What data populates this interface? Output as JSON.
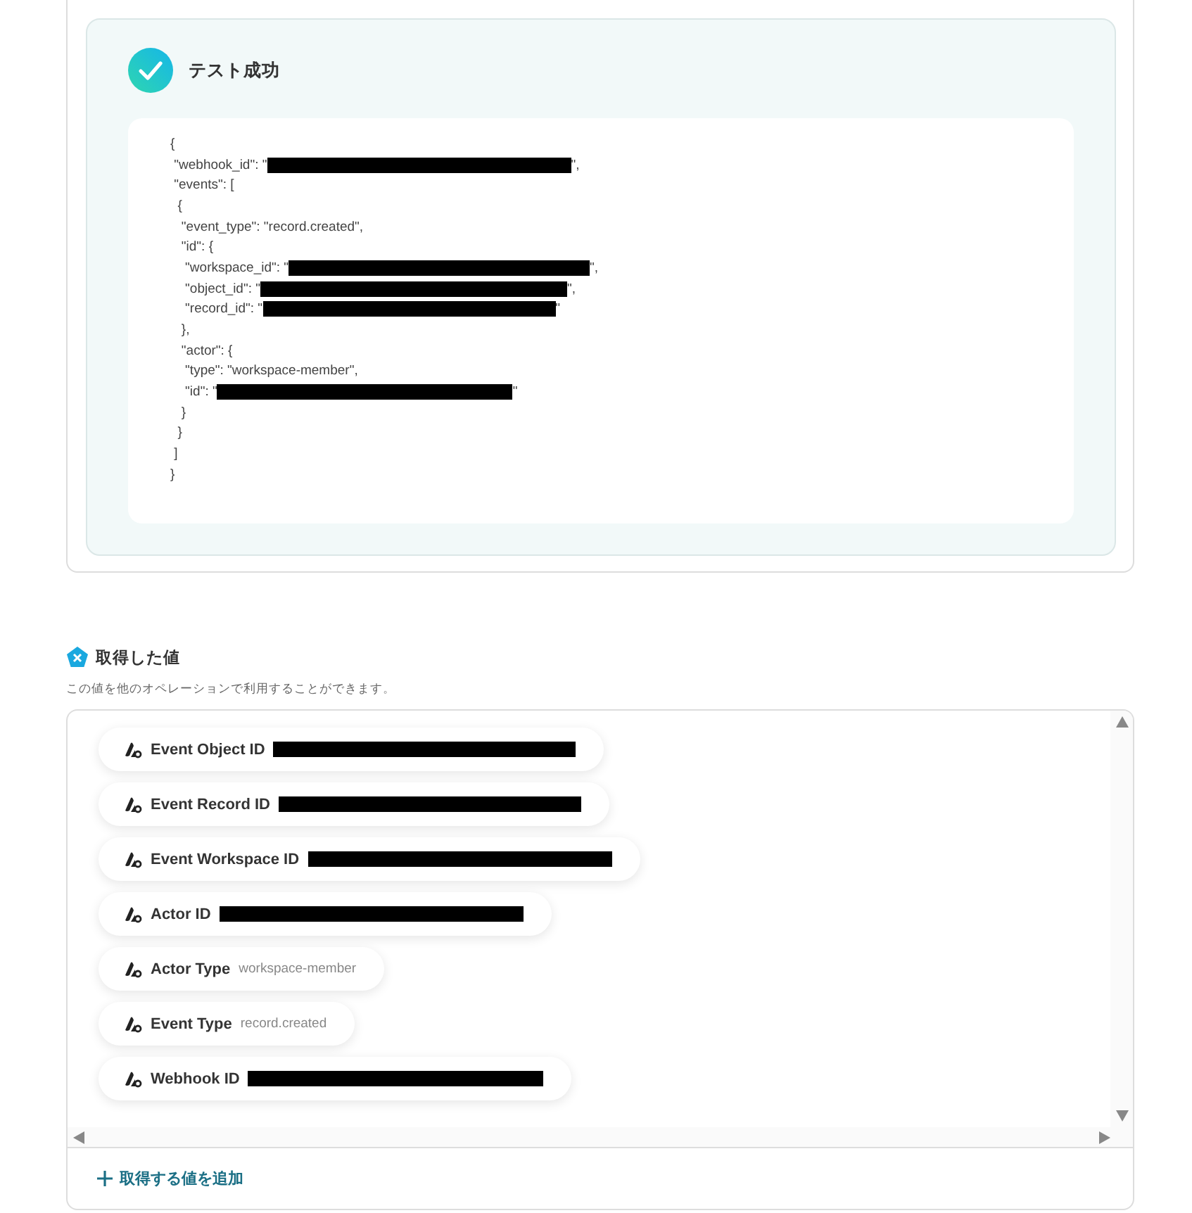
{
  "test_result": {
    "title": "テスト成功",
    "success": true,
    "code_lines": [
      {
        "text": "{"
      },
      {
        "text": " \"webhook_id\": \"",
        "redacted": true,
        "after": "\","
      },
      {
        "text": " \"events\": ["
      },
      {
        "text": "  {"
      },
      {
        "text": "   \"event_type\": \"record.created\","
      },
      {
        "text": "   \"id\": {"
      },
      {
        "text": "    \"workspace_id\": \"",
        "redacted": true,
        "after": "\","
      },
      {
        "text": "    \"object_id\": \"",
        "redacted": true,
        "after": "\","
      },
      {
        "text": "    \"record_id\": \"",
        "redacted": true,
        "after": "\""
      },
      {
        "text": "   },"
      },
      {
        "text": "   \"actor\": {"
      },
      {
        "text": "    \"type\": \"workspace-member\","
      },
      {
        "text": "    \"id\": \"",
        "redacted": true,
        "after": "\""
      },
      {
        "text": "   }"
      },
      {
        "text": "  }"
      },
      {
        "text": " ]"
      },
      {
        "text": "}"
      }
    ]
  },
  "retrieved_values": {
    "title": "取得した値",
    "description": "この値を他のオペレーションで利用することができます。",
    "items": [
      {
        "label": "Event Object ID",
        "redacted": true
      },
      {
        "label": "Event Record ID",
        "redacted": true
      },
      {
        "label": "Event Workspace ID",
        "redacted": true
      },
      {
        "label": "Actor ID",
        "redacted": true
      },
      {
        "label": "Actor Type",
        "redacted": false,
        "value": "workspace-member"
      },
      {
        "label": "Event Type",
        "redacted": false,
        "value": "record.created"
      },
      {
        "label": "Webhook ID",
        "redacted": true
      }
    ],
    "add_button": "取得する値を追加"
  }
}
